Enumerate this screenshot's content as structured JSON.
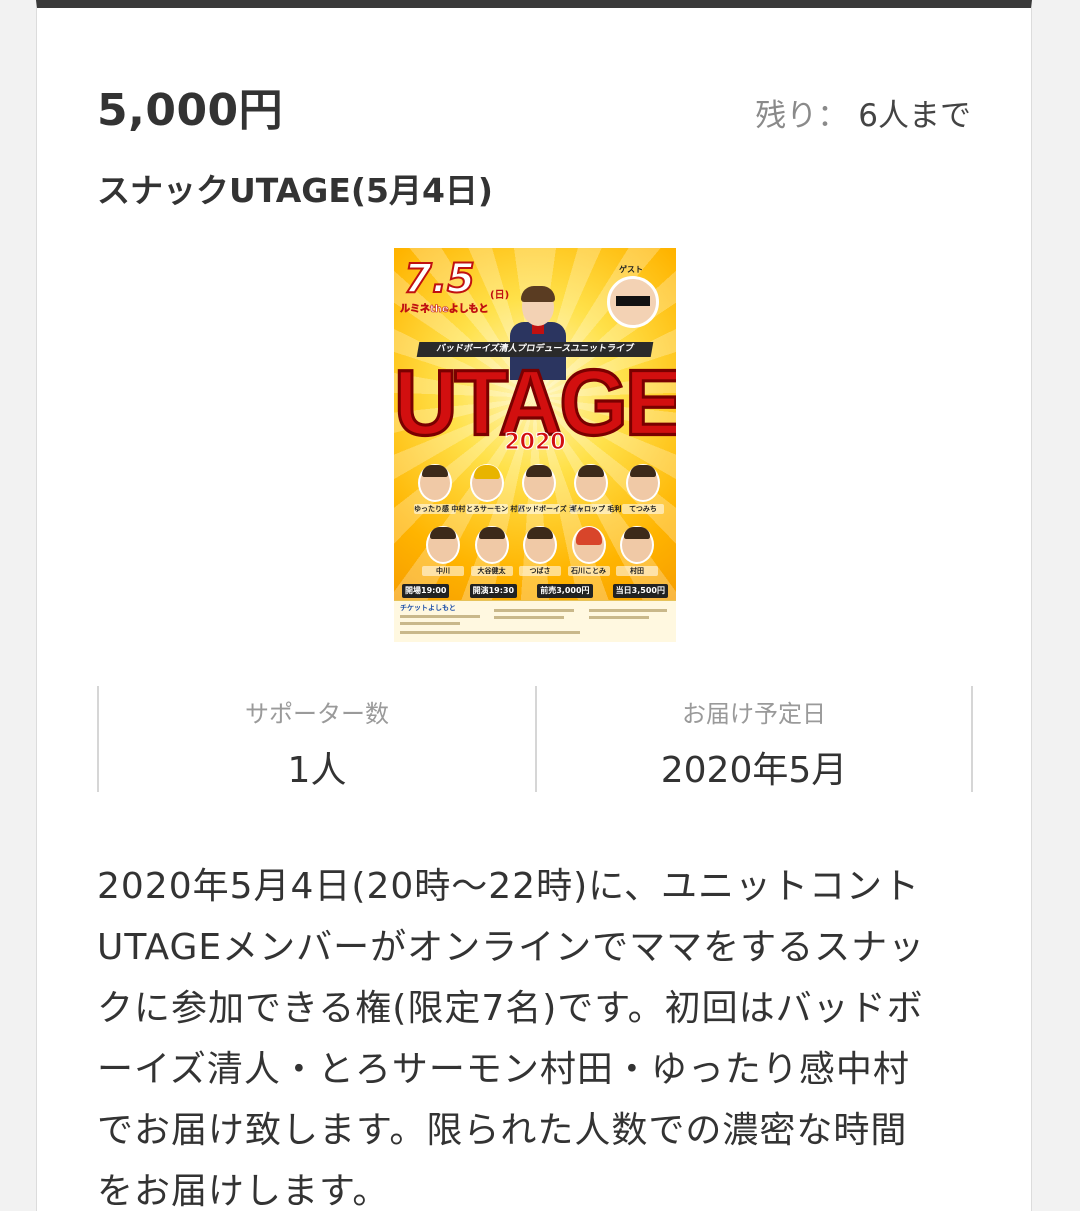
{
  "product": {
    "price": "5,000円",
    "remaining_label": "残り：",
    "remaining_value": "6人まで",
    "title": "スナックUTAGE(5月4日)"
  },
  "poster": {
    "date": "7.5",
    "day_of_week": "(日)",
    "venue": "ルミネtheよしもと",
    "guest_label": "ゲスト",
    "subtitle": "バッドボーイズ清人プロデュースユニットライブ",
    "logo": "UTAGE",
    "year": "2020",
    "members_row1": [
      "ゆったり感 中村",
      "とろサーモン 村田",
      "バッドボーイズ 清人",
      "ギャロップ 毛利",
      "てつみち"
    ],
    "members_row2": [
      "中川",
      "大谷健太",
      "つばさ",
      "石川ことみ",
      "村田"
    ],
    "times": [
      "開場19:00",
      "開演19:30",
      "前売3,000円",
      "当日3,500円"
    ],
    "footer_brand": "チケットよしもと"
  },
  "stats": {
    "supporters_label": "サポーター数",
    "supporters_value": "1人",
    "delivery_label": "お届け予定日",
    "delivery_value": "2020年5月"
  },
  "description": {
    "lines": [
      "2020年5月4日(20時〜22時)に、ユニットコント",
      "UTAGEメンバーがオンラインでママをするスナッ",
      "クに参加できる権(限定7名)です。初回はバッドボ",
      "ーイズ清人・とろサーモン村田・ゆったり感中村",
      "でお届け致します。限られた人数での濃密な時間",
      "をお届けします。"
    ]
  }
}
